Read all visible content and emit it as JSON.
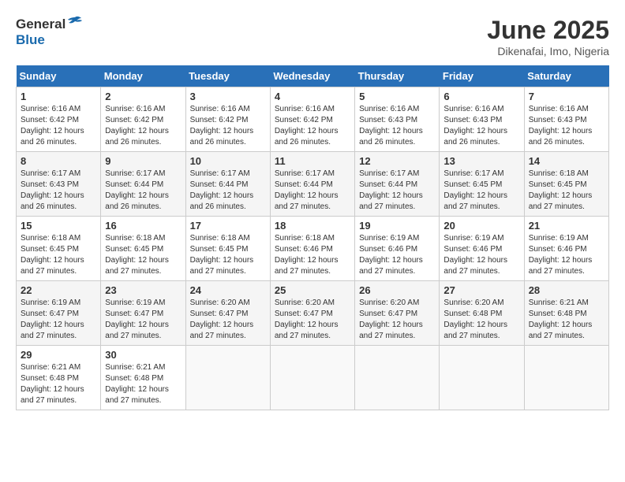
{
  "header": {
    "logo_general": "General",
    "logo_blue": "Blue",
    "title": "June 2025",
    "subtitle": "Dikenafai, Imo, Nigeria"
  },
  "weekdays": [
    "Sunday",
    "Monday",
    "Tuesday",
    "Wednesday",
    "Thursday",
    "Friday",
    "Saturday"
  ],
  "weeks": [
    [
      {
        "day": "1",
        "info": "Sunrise: 6:16 AM\nSunset: 6:42 PM\nDaylight: 12 hours\nand 26 minutes."
      },
      {
        "day": "2",
        "info": "Sunrise: 6:16 AM\nSunset: 6:42 PM\nDaylight: 12 hours\nand 26 minutes."
      },
      {
        "day": "3",
        "info": "Sunrise: 6:16 AM\nSunset: 6:42 PM\nDaylight: 12 hours\nand 26 minutes."
      },
      {
        "day": "4",
        "info": "Sunrise: 6:16 AM\nSunset: 6:42 PM\nDaylight: 12 hours\nand 26 minutes."
      },
      {
        "day": "5",
        "info": "Sunrise: 6:16 AM\nSunset: 6:43 PM\nDaylight: 12 hours\nand 26 minutes."
      },
      {
        "day": "6",
        "info": "Sunrise: 6:16 AM\nSunset: 6:43 PM\nDaylight: 12 hours\nand 26 minutes."
      },
      {
        "day": "7",
        "info": "Sunrise: 6:16 AM\nSunset: 6:43 PM\nDaylight: 12 hours\nand 26 minutes."
      }
    ],
    [
      {
        "day": "8",
        "info": "Sunrise: 6:17 AM\nSunset: 6:43 PM\nDaylight: 12 hours\nand 26 minutes."
      },
      {
        "day": "9",
        "info": "Sunrise: 6:17 AM\nSunset: 6:44 PM\nDaylight: 12 hours\nand 26 minutes."
      },
      {
        "day": "10",
        "info": "Sunrise: 6:17 AM\nSunset: 6:44 PM\nDaylight: 12 hours\nand 26 minutes."
      },
      {
        "day": "11",
        "info": "Sunrise: 6:17 AM\nSunset: 6:44 PM\nDaylight: 12 hours\nand 27 minutes."
      },
      {
        "day": "12",
        "info": "Sunrise: 6:17 AM\nSunset: 6:44 PM\nDaylight: 12 hours\nand 27 minutes."
      },
      {
        "day": "13",
        "info": "Sunrise: 6:17 AM\nSunset: 6:45 PM\nDaylight: 12 hours\nand 27 minutes."
      },
      {
        "day": "14",
        "info": "Sunrise: 6:18 AM\nSunset: 6:45 PM\nDaylight: 12 hours\nand 27 minutes."
      }
    ],
    [
      {
        "day": "15",
        "info": "Sunrise: 6:18 AM\nSunset: 6:45 PM\nDaylight: 12 hours\nand 27 minutes."
      },
      {
        "day": "16",
        "info": "Sunrise: 6:18 AM\nSunset: 6:45 PM\nDaylight: 12 hours\nand 27 minutes."
      },
      {
        "day": "17",
        "info": "Sunrise: 6:18 AM\nSunset: 6:45 PM\nDaylight: 12 hours\nand 27 minutes."
      },
      {
        "day": "18",
        "info": "Sunrise: 6:18 AM\nSunset: 6:46 PM\nDaylight: 12 hours\nand 27 minutes."
      },
      {
        "day": "19",
        "info": "Sunrise: 6:19 AM\nSunset: 6:46 PM\nDaylight: 12 hours\nand 27 minutes."
      },
      {
        "day": "20",
        "info": "Sunrise: 6:19 AM\nSunset: 6:46 PM\nDaylight: 12 hours\nand 27 minutes."
      },
      {
        "day": "21",
        "info": "Sunrise: 6:19 AM\nSunset: 6:46 PM\nDaylight: 12 hours\nand 27 minutes."
      }
    ],
    [
      {
        "day": "22",
        "info": "Sunrise: 6:19 AM\nSunset: 6:47 PM\nDaylight: 12 hours\nand 27 minutes."
      },
      {
        "day": "23",
        "info": "Sunrise: 6:19 AM\nSunset: 6:47 PM\nDaylight: 12 hours\nand 27 minutes."
      },
      {
        "day": "24",
        "info": "Sunrise: 6:20 AM\nSunset: 6:47 PM\nDaylight: 12 hours\nand 27 minutes."
      },
      {
        "day": "25",
        "info": "Sunrise: 6:20 AM\nSunset: 6:47 PM\nDaylight: 12 hours\nand 27 minutes."
      },
      {
        "day": "26",
        "info": "Sunrise: 6:20 AM\nSunset: 6:47 PM\nDaylight: 12 hours\nand 27 minutes."
      },
      {
        "day": "27",
        "info": "Sunrise: 6:20 AM\nSunset: 6:48 PM\nDaylight: 12 hours\nand 27 minutes."
      },
      {
        "day": "28",
        "info": "Sunrise: 6:21 AM\nSunset: 6:48 PM\nDaylight: 12 hours\nand 27 minutes."
      }
    ],
    [
      {
        "day": "29",
        "info": "Sunrise: 6:21 AM\nSunset: 6:48 PM\nDaylight: 12 hours\nand 27 minutes."
      },
      {
        "day": "30",
        "info": "Sunrise: 6:21 AM\nSunset: 6:48 PM\nDaylight: 12 hours\nand 27 minutes."
      },
      {
        "day": "",
        "info": ""
      },
      {
        "day": "",
        "info": ""
      },
      {
        "day": "",
        "info": ""
      },
      {
        "day": "",
        "info": ""
      },
      {
        "day": "",
        "info": ""
      }
    ]
  ]
}
